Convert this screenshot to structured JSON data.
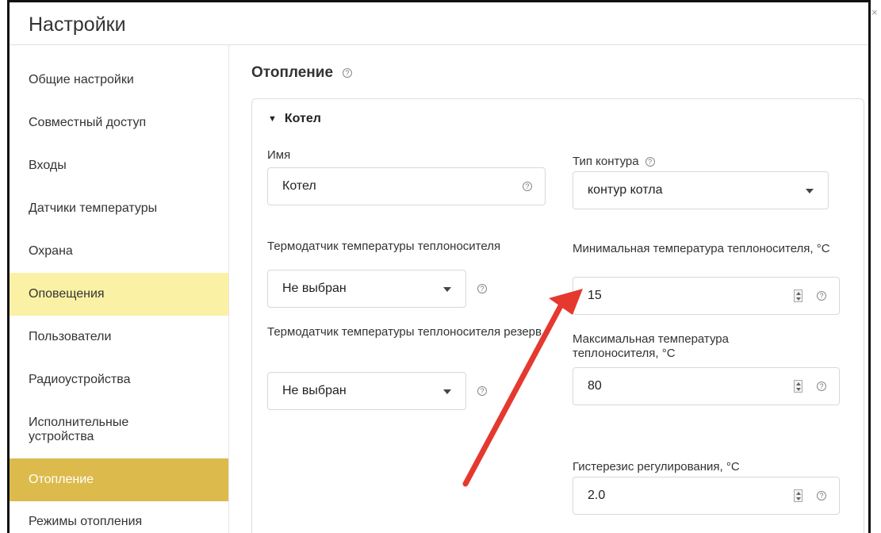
{
  "window": {
    "title": "Настройки",
    "close_glyph": "×"
  },
  "sidebar": {
    "items": [
      {
        "label": "Общие настройки"
      },
      {
        "label": "Совместный доступ"
      },
      {
        "label": "Входы"
      },
      {
        "label": "Датчики температуры"
      },
      {
        "label": "Охрана"
      },
      {
        "label": "Оповещения"
      },
      {
        "label": "Пользователи"
      },
      {
        "label": "Радиоустройства"
      },
      {
        "label": "Исполнительные устройства"
      },
      {
        "label": "Отопление"
      },
      {
        "label": "Режимы отопления"
      }
    ],
    "highlighted": "Оповещения",
    "active": "Отопление"
  },
  "main": {
    "section_title": "Отопление",
    "card": {
      "title": "Котел",
      "name_label": "Имя",
      "name_value": "Котел",
      "circuit_type_label": "Тип контура",
      "circuit_type_value": "контур котла",
      "sensor_label": "Термодатчик температуры теплоносителя",
      "sensor_value": "Не выбран",
      "sensor_reserve_label": "Термодатчик температуры теплоносителя резерв",
      "sensor_reserve_value": "Не выбран",
      "min_temp_label": "Минимальная температура теплоносителя, °C",
      "min_temp_value": "15",
      "max_temp_label": "Максимальная температура теплоносителя, °C",
      "max_temp_value": "80",
      "hysteresis_label": "Гистерезис регулирования, °C",
      "hysteresis_value": "2.0"
    }
  },
  "colors": {
    "highlight": "#fbf1a5",
    "active": "#dcbb4c",
    "annotation_arrow": "#e5392f"
  },
  "icons": {
    "help": "question-circle-icon",
    "caret": "caret-down-icon",
    "close": "close-icon"
  }
}
